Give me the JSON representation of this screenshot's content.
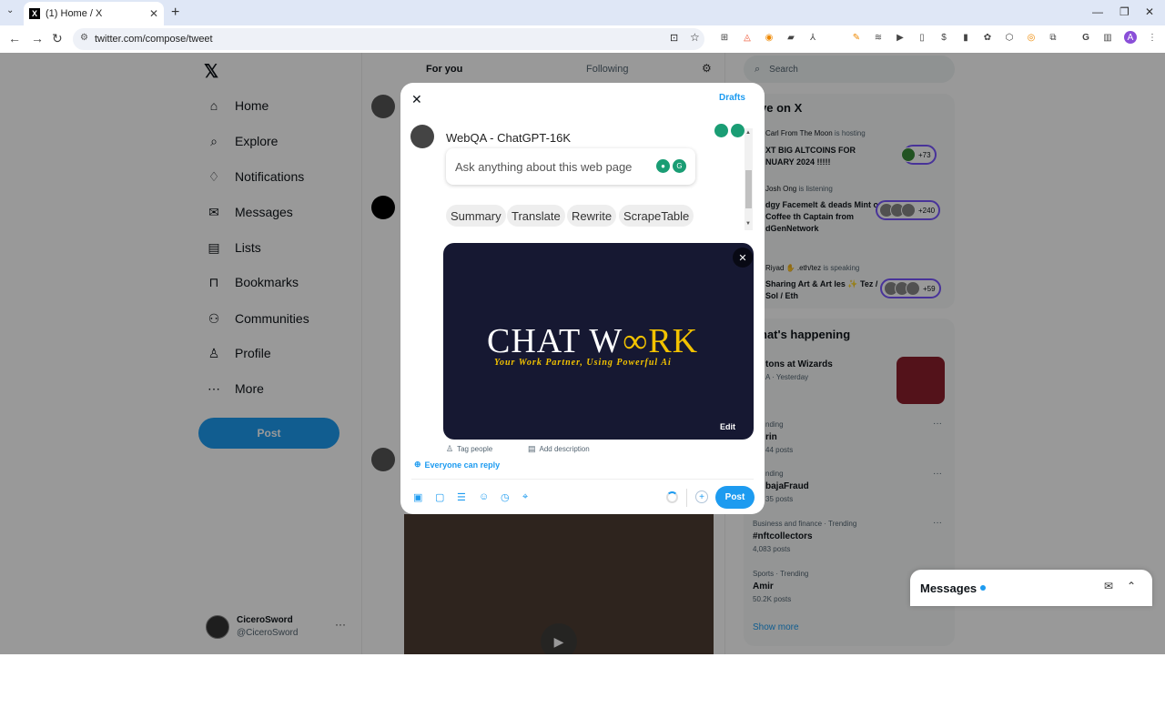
{
  "browser": {
    "tab_title": "(1) Home / X",
    "tab_favicon": "X",
    "url": "twitter.com/compose/tweet"
  },
  "sidebar": {
    "logo": "𝕏",
    "items": [
      {
        "label": "Home",
        "icon": "home-icon",
        "glyph": "⌂"
      },
      {
        "label": "Explore",
        "icon": "search-icon",
        "glyph": "⌕"
      },
      {
        "label": "Notifications",
        "icon": "bell-icon",
        "glyph": "♢"
      },
      {
        "label": "Messages",
        "icon": "mail-icon",
        "glyph": "✉"
      },
      {
        "label": "Lists",
        "icon": "list-icon",
        "glyph": "▤"
      },
      {
        "label": "Bookmarks",
        "icon": "bookmark-icon",
        "glyph": "⊓"
      },
      {
        "label": "Communities",
        "icon": "people-icon",
        "glyph": "⚇"
      },
      {
        "label": "Profile",
        "icon": "person-icon",
        "glyph": "♙"
      },
      {
        "label": "More",
        "icon": "more-circle-icon",
        "glyph": "⋯"
      }
    ],
    "post_label": "Post",
    "account": {
      "name": "CiceroSword",
      "handle": "@CiceroSword"
    }
  },
  "feed": {
    "tabs": {
      "for_you": "For you",
      "following": "Following"
    }
  },
  "right": {
    "search_placeholder": "Search",
    "live_title": "ve on X",
    "spaces": [
      {
        "host": "Carl From The Moon",
        "verb": "is hosting",
        "title": "XT BIG ALTCOINS FOR NUARY 2024 !!!!!",
        "count": "+73"
      },
      {
        "host": "Josh Ong",
        "verb": "is listening",
        "title": "dgy Facemelt & deads Mint on Coffee th Captain from dGenNetwork",
        "count": "+240"
      },
      {
        "host": "Riyad ✋ .eth/tez",
        "verb": "is speaking",
        "title": "Sharing Art & Art les ✨ Tez / Sol / Eth",
        "count": "+59"
      }
    ],
    "happening_title": "hat's happening",
    "trends": [
      {
        "category": "",
        "name": "tons at Wizards",
        "count": "A · Yesterday"
      },
      {
        "category": "nding",
        "name": "rin",
        "count": "44 posts"
      },
      {
        "category": "nding",
        "name": "bajaFraud",
        "count": "35 posts"
      },
      {
        "category": "Business and finance · Trending",
        "name": "#nftcollectors",
        "count": "4,083 posts"
      },
      {
        "category": "Sports · Trending",
        "name": "Amir",
        "count": "50.2K posts"
      }
    ],
    "show_more": "Show more"
  },
  "messages_dock": {
    "label": "Messages"
  },
  "composer": {
    "drafts": "Drafts",
    "webqa": {
      "title": "WebQA - ChatGPT-16K",
      "placeholder": "Ask anything about this web page",
      "actions": [
        "Summary",
        "Translate",
        "Rewrite",
        "ScrapeTable"
      ]
    },
    "media": {
      "brand_white": "CHAT W",
      "brand_gold_o": "∞",
      "brand_gold": "RK",
      "tagline": "Your Work Partner, Using Powerful Ai",
      "edit": "Edit"
    },
    "tag_people": "Tag people",
    "add_description": "Add description",
    "reply_setting": "Everyone can reply",
    "post_label": "Post"
  },
  "colors": {
    "accent": "#1d9bf0",
    "space_border": "#7856ff"
  }
}
